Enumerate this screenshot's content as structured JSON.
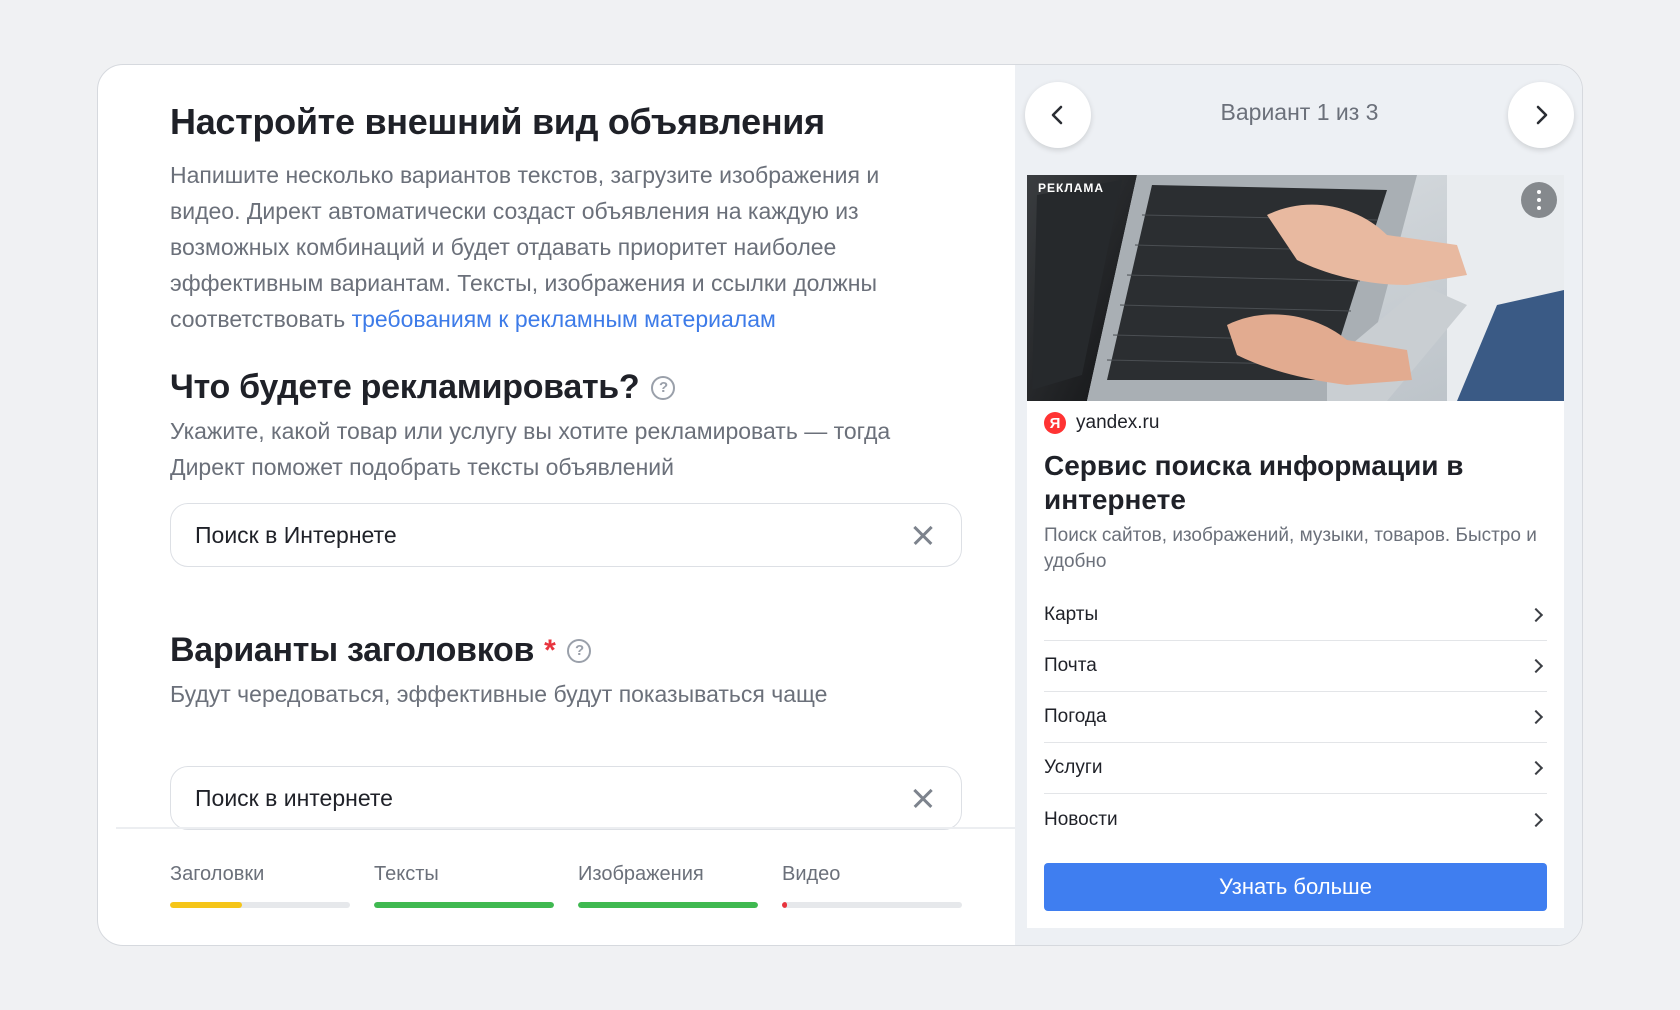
{
  "editor": {
    "title": "Настройте внешний вид объявления",
    "description": "Напишите несколько вариантов текстов, загрузите изображения и видео. Директ автоматически создаст объявления на каждую из возможных комбинаций и будет отдавать приоритет наиболее эффективным вариантам. Тексты, изображения и ссылки должны соответствовать ",
    "description_link": "требованиям к рекламным материалам",
    "product": {
      "title": "Что будете рекламировать?",
      "subtitle": "Укажите, какой товар или услугу вы хотите рекламировать — тогда Директ поможет подобрать тексты объявлений",
      "value": "Поиск в Интернете"
    },
    "headlines": {
      "title": "Варианты заголовков",
      "required_mark": "*",
      "subtitle": "Будут чередоваться, эффективные будут показываться чаще",
      "value": "Поиск в интернете"
    },
    "help_glyph": "?",
    "progress": [
      {
        "label": "Заголовки",
        "fill": 0.4,
        "color": "#f5c518"
      },
      {
        "label": "Тексты",
        "fill": 1.0,
        "color": "#3fb950"
      },
      {
        "label": "Изображения",
        "fill": 1.0,
        "color": "#3fb950"
      },
      {
        "label": "Видео",
        "fill": 0.03,
        "color": "#e8343e"
      }
    ]
  },
  "preview": {
    "variant_label": "Вариант 1 из 3",
    "prev_icon": "chevron-left-icon",
    "next_icon": "chevron-right-icon",
    "ad_label": "РЕКЛАМА",
    "logo_letter": "Я",
    "domain": "yandex.ru",
    "title": "Сервис поиска информации в интернете",
    "text": "Поиск сайтов, изображений, музыки, товаров. Быстро и удобно",
    "sitelinks": [
      "Карты",
      "Почта",
      "Погода",
      "Услуги",
      "Новости"
    ],
    "cta": "Узнать больше"
  }
}
